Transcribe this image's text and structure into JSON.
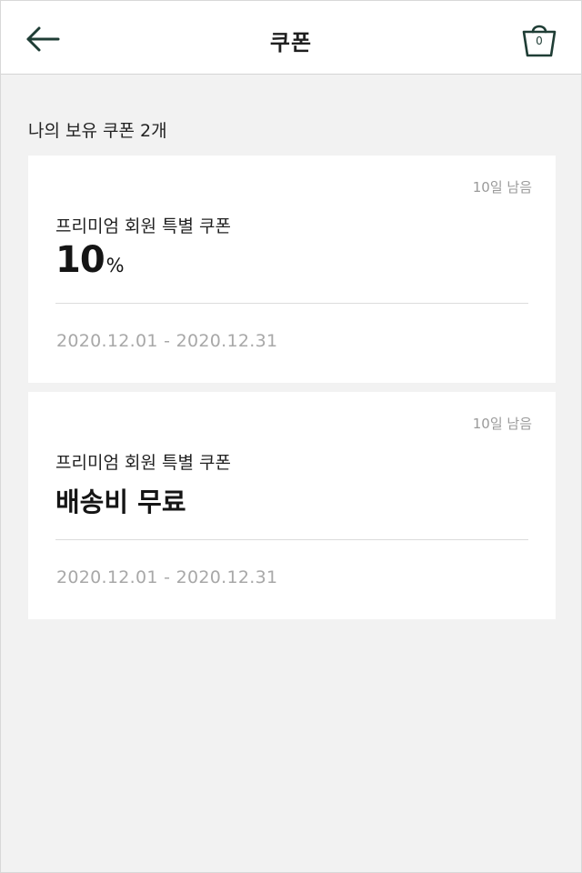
{
  "header": {
    "title": "쿠폰",
    "back_icon": "arrow-left-icon",
    "cart_icon": "shopping-basket-icon",
    "cart_count": "0"
  },
  "summary": {
    "label": "나의 보유 쿠폰 2개"
  },
  "coupons": [
    {
      "remaining": "10일 남음",
      "name": "프리미엄 회원 특별 쿠폰",
      "benefit_value": "10",
      "benefit_unit": "%",
      "period": "2020.12.01 - 2020.12.31"
    },
    {
      "remaining": "10일 남음",
      "name": "프리미엄 회원 특별 쿠폰",
      "benefit_text": "배송비 무료",
      "period": "2020.12.01 - 2020.12.31"
    }
  ],
  "colors": {
    "header_bg": "#ffffff",
    "page_bg": "#f2f2f2",
    "icon_color": "#1f3d35",
    "muted_text": "#9a9a9a"
  }
}
